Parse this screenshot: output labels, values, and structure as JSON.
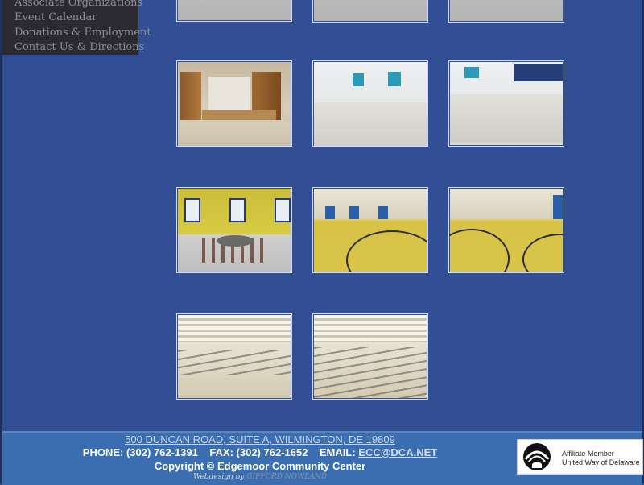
{
  "nav": {
    "items": [
      {
        "label": "Associate Organizations"
      },
      {
        "label": "Event Calendar"
      },
      {
        "label": "Donations & Employment"
      },
      {
        "label": "Contact Us & Directions"
      }
    ]
  },
  "gallery": {
    "photos": [
      {
        "name": "top-row-photo-1"
      },
      {
        "name": "top-row-photo-2"
      },
      {
        "name": "top-row-photo-3"
      },
      {
        "name": "stage-photo"
      },
      {
        "name": "meeting-room-photo"
      },
      {
        "name": "meeting-room-photo-2"
      },
      {
        "name": "classroom-photo"
      },
      {
        "name": "gymnasium-photo"
      },
      {
        "name": "gymnasium-photo-2"
      },
      {
        "name": "cafeteria-photo"
      },
      {
        "name": "cafeteria-photo-2"
      }
    ]
  },
  "footer": {
    "address": "500 DUNCAN ROAD, SUITE A, WILMINGTON, DE 19809",
    "phone_label": "PHONE: (302) 762-1391",
    "fax_label": "FAX: (302) 762-1652",
    "email_prefix": "EMAIL:",
    "email": "ECC@DCA.NET",
    "copyright": "Copyright © Edgemoor Community Center",
    "webdesign_prefix": "Webdesign by",
    "webdesign_name": "GIFFORD NOWLAND"
  },
  "affiliate": {
    "line1": "Affiliate Member",
    "line2": "United Way of Delaware"
  },
  "colors": {
    "background": "#324e95",
    "footer": "#3a6eb1",
    "nav_box": "#2a2a30"
  }
}
